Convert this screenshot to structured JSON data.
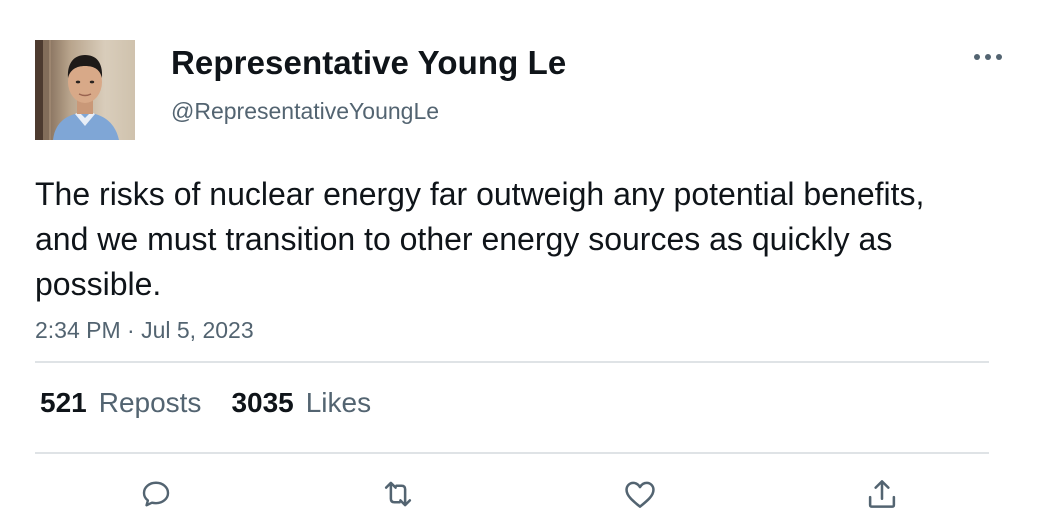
{
  "user": {
    "display_name": "Representative Young Le",
    "handle": "@RepresentativeYoungLe"
  },
  "tweet": {
    "text": "The risks of nuclear energy far outweigh any potential benefits, and we must transition to other energy sources as quickly as possible.",
    "timestamp": "2:34 PM · Jul 5, 2023"
  },
  "stats": {
    "reposts_count": "521",
    "reposts_label": "Reposts",
    "likes_count": "3035",
    "likes_label": "Likes"
  },
  "icons": {
    "more": "more-horizontal-icon",
    "reply": "reply-icon",
    "repost": "repost-icon",
    "like": "heart-icon",
    "share": "share-icon"
  },
  "colors": {
    "text_primary": "#0f1419",
    "text_secondary": "#536471",
    "divider": "#dfe3e6",
    "icon": "#536471"
  }
}
